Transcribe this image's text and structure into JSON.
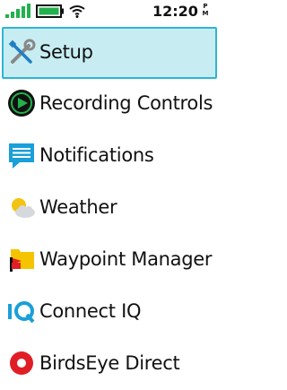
{
  "status": {
    "time": "12:20",
    "ampm_top": "P",
    "ampm_bottom": "M",
    "battery_color": "#22b14c",
    "signal_color": "#22b14c",
    "icons": [
      "signal-icon",
      "battery-icon",
      "wifi-icon"
    ]
  },
  "menu": {
    "items": [
      {
        "label": "Setup",
        "icon": "wrench-screwdriver-icon",
        "selected": true
      },
      {
        "label": "Recording Controls",
        "icon": "recording-play-icon"
      },
      {
        "label": "Notifications",
        "icon": "message-icon"
      },
      {
        "label": "Weather",
        "icon": "partly-cloudy-icon"
      },
      {
        "label": "Waypoint Manager",
        "icon": "folder-flag-icon"
      },
      {
        "label": "Connect IQ",
        "icon": "connect-iq-icon"
      },
      {
        "label": "BirdsEye Direct",
        "icon": "birdseye-icon"
      }
    ]
  },
  "colors": {
    "selected_bg": "#c7edf2",
    "selected_border": "#2fb4d5",
    "accent_blue": "#1a9fd9"
  }
}
